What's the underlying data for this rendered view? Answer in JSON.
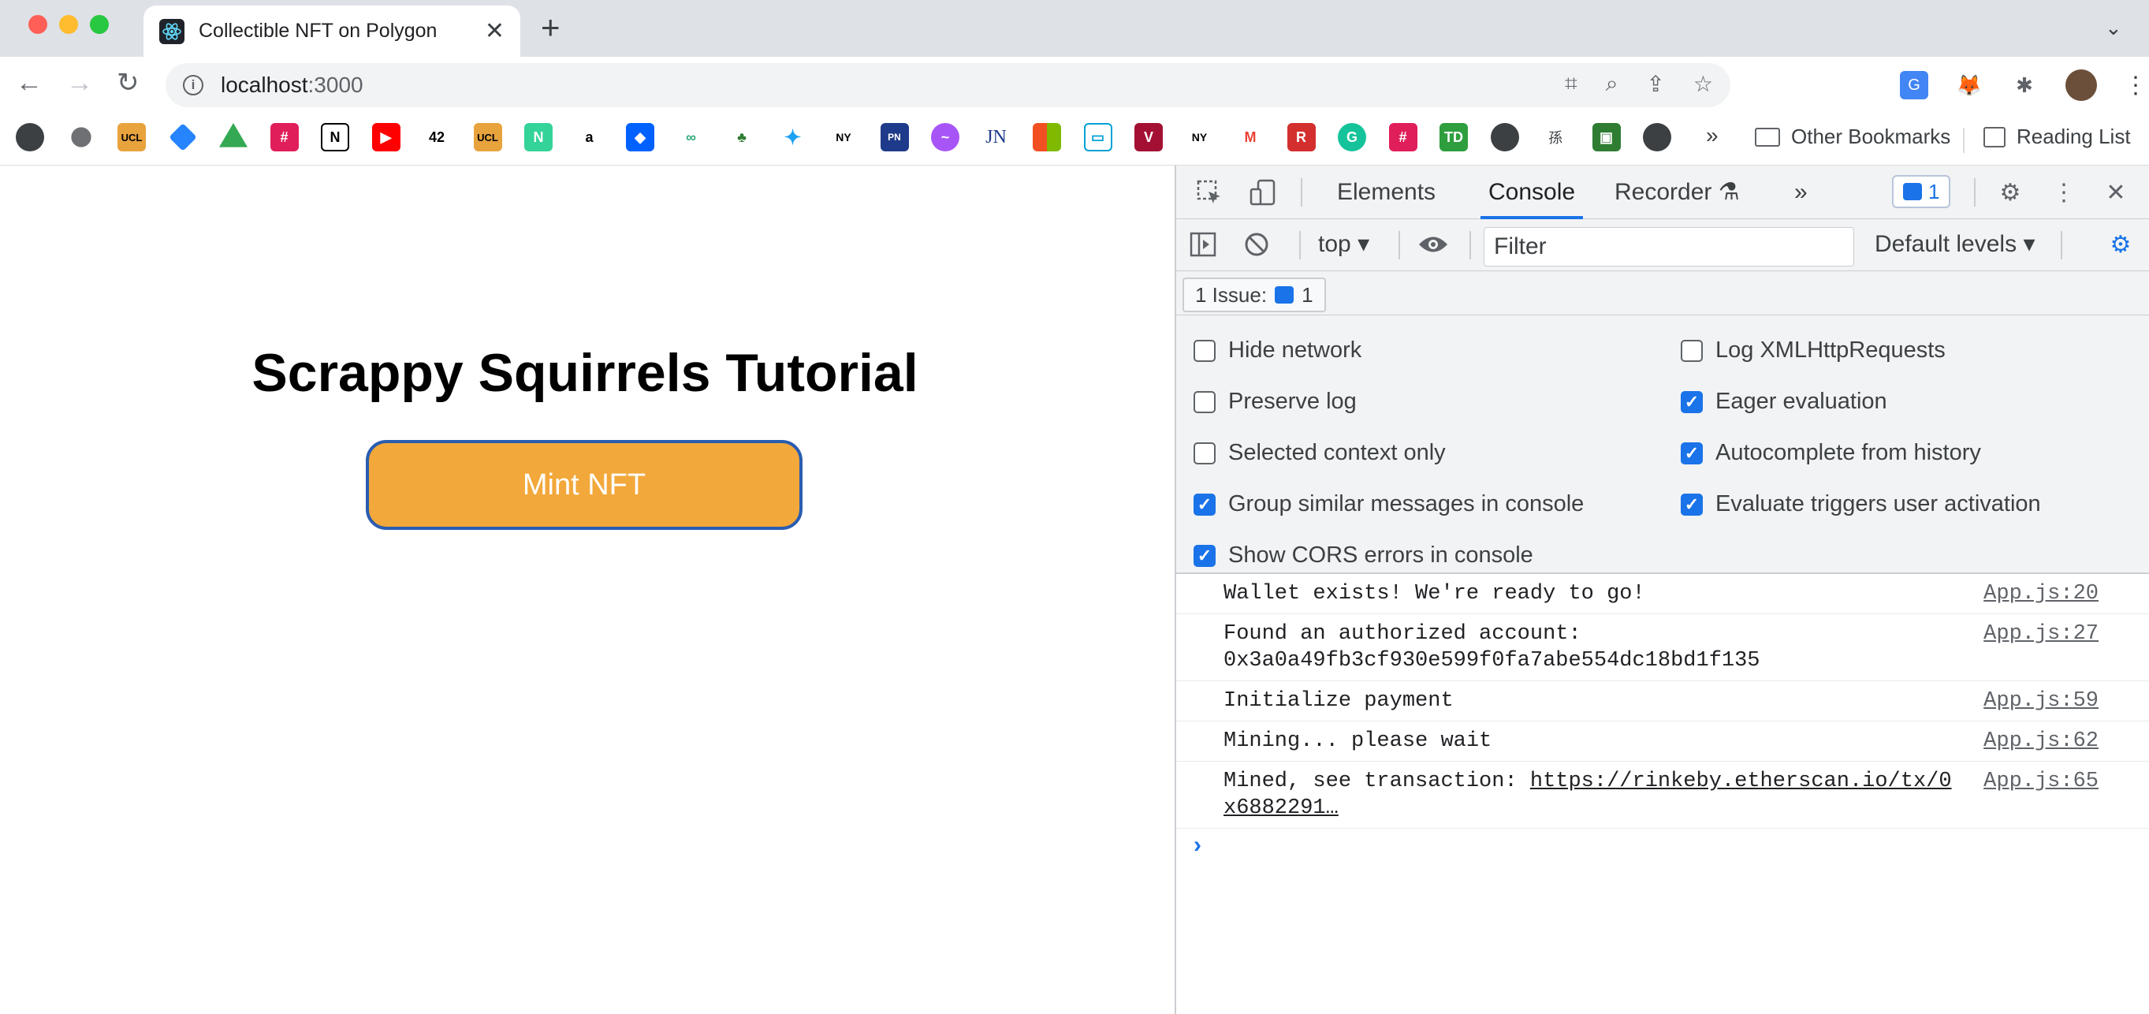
{
  "browser": {
    "tab_title": "Collectible NFT on Polygon",
    "new_tab": "+",
    "url_host": "localhost",
    "url_port": ":3000",
    "bookmark_more": "»",
    "other_bookmarks": "Other Bookmarks",
    "reading_list": "Reading List"
  },
  "page": {
    "title": "Scrappy Squirrels Tutorial",
    "mint_button": "Mint NFT"
  },
  "devtools": {
    "tabs": [
      "Elements",
      "Console",
      "Recorder"
    ],
    "more_tabs": "»",
    "badge_count": "1",
    "context": "top",
    "filter_placeholder": "Filter",
    "levels": "Default levels",
    "issues_label": "1 Issue:",
    "issues_count": "1",
    "options_left": [
      {
        "label": "Hide network",
        "checked": false
      },
      {
        "label": "Preserve log",
        "checked": false
      },
      {
        "label": "Selected context only",
        "checked": false
      },
      {
        "label": "Group similar messages in console",
        "checked": true
      },
      {
        "label": "Show CORS errors in console",
        "checked": true
      }
    ],
    "options_right": [
      {
        "label": "Log XMLHttpRequests",
        "checked": false
      },
      {
        "label": "Eager evaluation",
        "checked": true
      },
      {
        "label": "Autocomplete from history",
        "checked": true
      },
      {
        "label": "Evaluate triggers user activation",
        "checked": true
      }
    ],
    "console_lines": [
      {
        "text": "Wallet exists! We're ready to go!",
        "source": "App.js:20"
      },
      {
        "text": "Found an authorized account:",
        "text2": "0x3a0a49fb3cf930e599f0fa7abe554dc18bd1f135",
        "source": "App.js:27"
      },
      {
        "text": "Initialize payment",
        "source": "App.js:59"
      },
      {
        "text": "Mining... please wait",
        "source": "App.js:62"
      },
      {
        "text": "Mined, see transaction: ",
        "link": "https://rinkeby.etherscan.io/tx/0",
        "link2": "x6882291…",
        "source": "App.js:65"
      }
    ],
    "prompt": "›"
  },
  "colors": {
    "accent": "#1a73e8",
    "mint_button": "#f2a83a",
    "mint_border": "#2a5db0"
  }
}
